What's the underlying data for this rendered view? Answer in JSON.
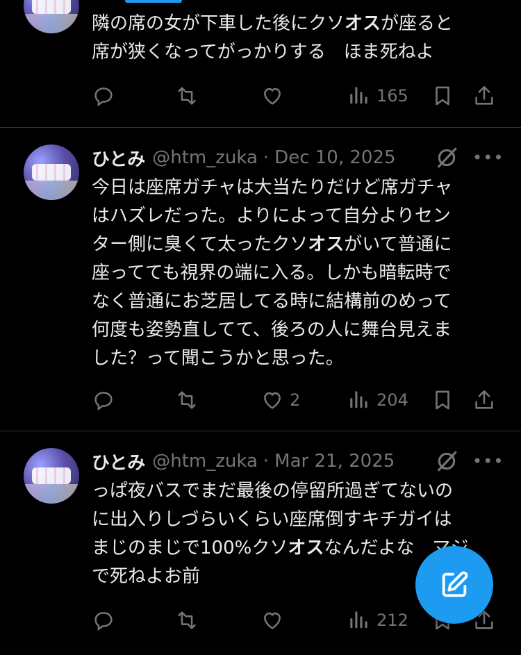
{
  "colors": {
    "background": "#000000",
    "text": "#e7e9ea",
    "muted": "#71767b",
    "accent": "#1d9bf0",
    "divider": "#2f3336"
  },
  "icons": [
    "reply-icon",
    "retweet-icon",
    "like-icon",
    "views-icon",
    "bookmark-icon",
    "share-icon",
    "grok-icon",
    "more-icon",
    "compose-icon"
  ],
  "tweets": [
    {
      "text_lines": [
        "隣の席の女が下車した後にクソ<b>オス</b>が座ると",
        "席が狭くなってがっかりする　ほま死ねよ"
      ],
      "reply_count": "",
      "retweet_count": "",
      "like_count": "",
      "view_count": "165"
    },
    {
      "name": "ひとみ",
      "handle": "@htm_zuka",
      "sep": "·",
      "date": "Dec 10, 2025",
      "text_lines": [
        "今日は座席ガチャは大当たりだけど席ガチャ",
        "はハズレだった。よりによって自分よりセン",
        "ター側に臭くて太ったクソ<b>オス</b>がいて普通に",
        "座ってても視界の端に入る。しかも暗転時で",
        "なく普通にお芝居してる時に結構前のめって",
        "何度も姿勢直してて、後ろの人に舞台見えま",
        "した？って聞こうかと思った。"
      ],
      "reply_count": "",
      "retweet_count": "",
      "like_count": "2",
      "view_count": "204"
    },
    {
      "name": "ひとみ",
      "handle": "@htm_zuka",
      "sep": "·",
      "date": "Mar 21, 2025",
      "text_lines": [
        "っぱ夜バスでまだ最後の停留所過ぎてないの",
        "に出入りしづらいくらい座席倒すキチガイは",
        "まじのまじで100%クソ<b>オス</b>なんだよな　マジ",
        "で死ねよお前"
      ],
      "reply_count": "",
      "retweet_count": "",
      "like_count": "",
      "view_count": "212"
    }
  ]
}
